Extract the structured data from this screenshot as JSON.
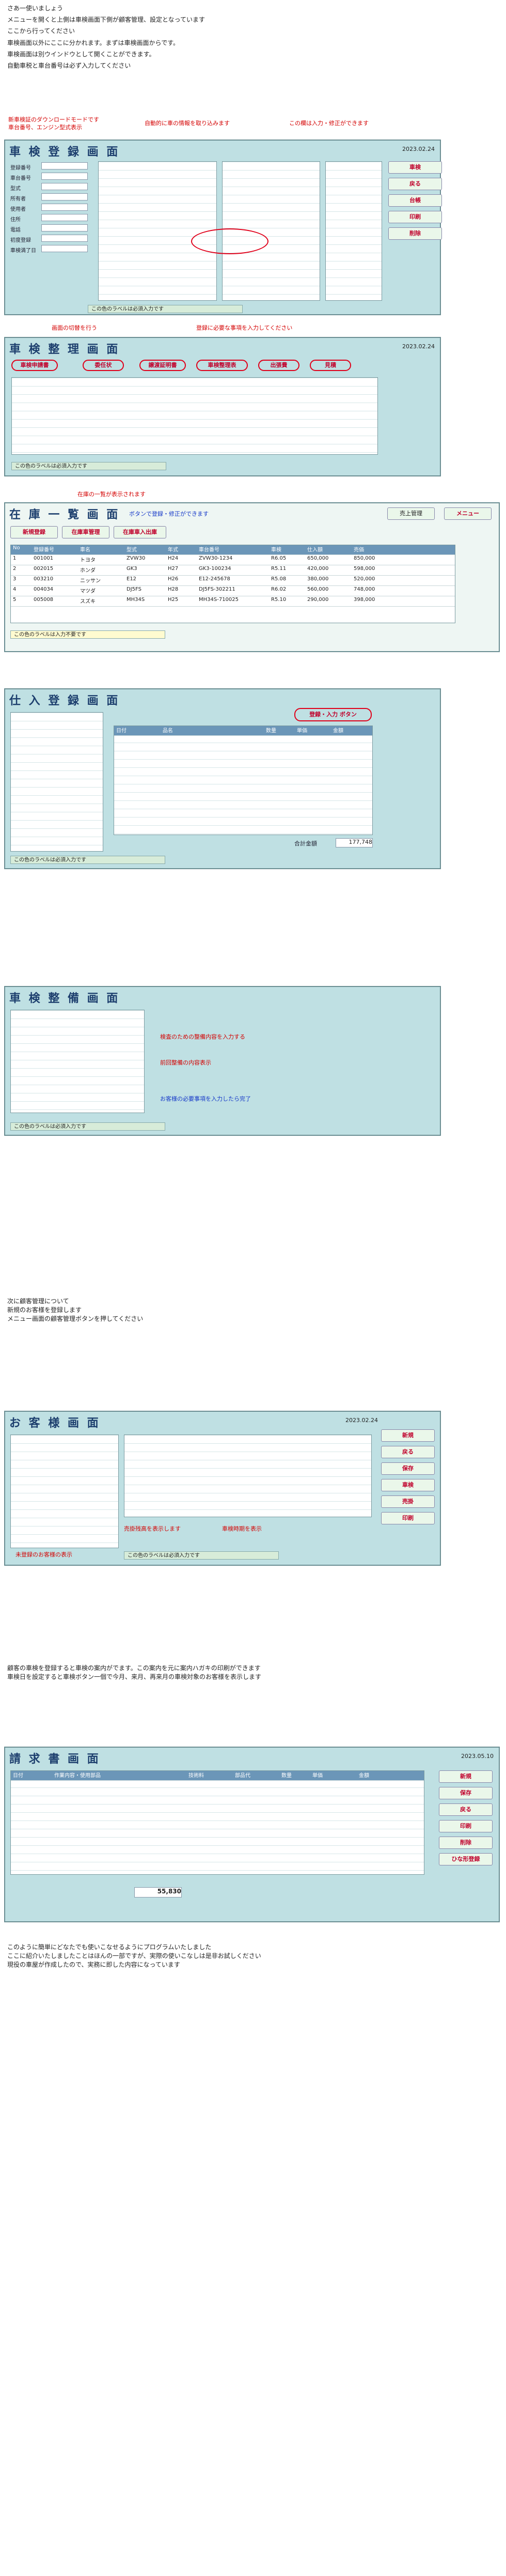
{
  "intro": {
    "title": "さあ一使いましょう",
    "lines": [
      "メニューを開くと上側は車検画面下側が顧客管理、設定となっています",
      "ここから行ってください",
      "車検画面以外にここに分かれます。まずは車検画面からです。",
      "車検画面は別ウインドウとして開くことができます。",
      "自動車税と車台番号は必ず入力してください"
    ]
  },
  "sec1": {
    "title": "車 検 登 録 画 面",
    "callouts": [
      "新車検証のダウンロードモードです",
      "車台番号、エンジン型式表示",
      "自動的に車の情報を取り込みます",
      "この欄は入力・修正ができます"
    ],
    "fields": [
      "登録番号",
      "車台番号",
      "型式",
      "所有者",
      "使用者",
      "住所",
      "電話",
      "初度登録",
      "車検満了日"
    ],
    "buttons": [
      "車検",
      "戻る",
      "台帳",
      "印刷",
      "削除"
    ],
    "status": "この色のラベルは必須入力です",
    "date": "2023.02.24"
  },
  "sec2": {
    "title": "車 検 整 理 画 面",
    "callouts": [
      "画面の切替を行う",
      "登録に必要な事項を入力してください"
    ],
    "tabs": [
      "車検申請書",
      "委任状",
      "譲渡証明書",
      "車検整理表",
      "出張費",
      "見積"
    ],
    "status": "この色のラベルは必須入力です",
    "date": "2023.02.24"
  },
  "sec3": {
    "title": "在 庫 一 覧 画 面",
    "notes": [
      "在庫の一覧が表示されます",
      "ボタンで登録・修正ができます"
    ],
    "buttons": [
      "新規登録",
      "在庫車管理",
      "在庫車入出庫",
      "売上管理",
      "メニュー"
    ],
    "headers": [
      "No",
      "登録番号",
      "車名",
      "型式",
      "年式",
      "車台番号",
      "車検",
      "仕入額",
      "売価"
    ],
    "rows": [
      [
        "1",
        "001001",
        "トヨタ",
        "ZVW30",
        "H24",
        "ZVW30-1234",
        "R6.05",
        "650,000",
        "850,000"
      ],
      [
        "2",
        "002015",
        "ホンダ",
        "GK3",
        "H27",
        "GK3-100234",
        "R5.11",
        "420,000",
        "598,000"
      ],
      [
        "3",
        "003210",
        "ニッサン",
        "E12",
        "H26",
        "E12-245678",
        "R5.08",
        "380,000",
        "520,000"
      ],
      [
        "4",
        "004034",
        "マツダ",
        "DJ5FS",
        "H28",
        "DJ5FS-302211",
        "R6.02",
        "560,000",
        "748,000"
      ],
      [
        "5",
        "005008",
        "スズキ",
        "MH34S",
        "H25",
        "MH34S-710025",
        "R5.10",
        "290,000",
        "398,000"
      ]
    ],
    "note_bottom": "この色のラベルは入力不要です"
  },
  "sec4": {
    "title": "仕 入 登 録 画 面",
    "callout": "登録・入力 ボタン",
    "headers": [
      "日付",
      "品名",
      "数量",
      "単価",
      "金額"
    ],
    "total_label": "合計金額",
    "total": "177,748",
    "status": "この色のラベルは必須入力です"
  },
  "sec5": {
    "title": "車 検 整 備 画 面",
    "callouts": [
      "検査のための整備内容を入力する",
      "前回整備の内容表示"
    ],
    "note": "お客様の必要事項を入力したら完了",
    "status": "この色のラベルは必須入力です"
  },
  "sec6": {
    "intro": [
      "次に顧客管理について",
      "新規のお客様を登録します",
      "メニュー画面の顧客管理ボタンを押してください"
    ],
    "title": "お 客 様 画 面",
    "callouts": [
      "未登録のお客様の表示",
      "売掛残高を表示します",
      "車検時期を表示"
    ],
    "buttons": [
      "新規",
      "戻る",
      "保存",
      "車検",
      "売掛",
      "印刷"
    ],
    "status": "この色のラベルは必須入力です",
    "date": "2023.02.24"
  },
  "sec7": {
    "text": [
      "顧客の車検を登録すると車検の案内がでます。この案内を元に案内ハガキの印刷ができます",
      "車検日を設定すると車検ボタン一個で今月、来月、再来月の車検対象のお客様を表示します"
    ],
    "title": "請 求 書 画 面",
    "headers": [
      "日付",
      "作業内容・使用部品",
      "技術料",
      "部品代",
      "数量",
      "単価",
      "金額"
    ],
    "total": "55,830",
    "buttons": [
      "新規",
      "保存",
      "戻る",
      "印刷",
      "削除",
      "ひな形登録"
    ],
    "date": "2023.05.10"
  },
  "outro": [
    "このように簡単にどなたでも使いこなせるようにプログラムいたしました",
    "ここに紹介いたしましたことはほんの一部ですが、実際の使いこなしは是非お試しください",
    "現役の車屋が作成したので、実務に即した内容になっています"
  ]
}
